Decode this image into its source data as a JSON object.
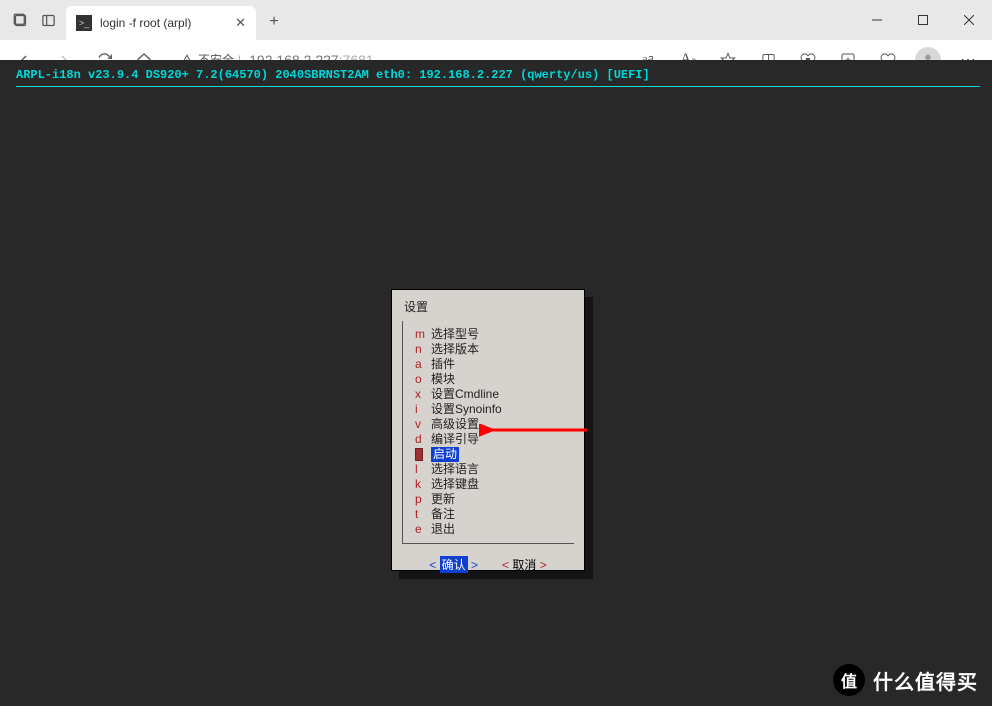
{
  "tab": {
    "title": "login -f root (arpl)"
  },
  "address": {
    "warn_text": "不安全",
    "host": "192.168.2.227",
    "port": ":7681"
  },
  "status_line": "ARPL-i18n v23.9.4 DS920+ 7.2(64570) 2040SBRNST2AM eth0: 192.168.2.227 (qwerty/us) [UEFI]",
  "dialog": {
    "title": "设置",
    "items": [
      {
        "key": "m",
        "label": "选择型号"
      },
      {
        "key": "n",
        "label": "选择版本"
      },
      {
        "key": "a",
        "label": "插件"
      },
      {
        "key": "o",
        "label": "模块"
      },
      {
        "key": "x",
        "label": "设置Cmdline"
      },
      {
        "key": "i",
        "label": "设置Synoinfo"
      },
      {
        "key": "v",
        "label": "高级设置"
      },
      {
        "key": "d",
        "label": "编译引导"
      },
      {
        "key": "",
        "label": "启动",
        "selected": true
      },
      {
        "key": "l",
        "label": "选择语言"
      },
      {
        "key": "k",
        "label": "选择键盘"
      },
      {
        "key": "p",
        "label": "更新"
      },
      {
        "key": "t",
        "label": "备注"
      },
      {
        "key": "e",
        "label": "退出"
      }
    ],
    "ok": "确认",
    "cancel": "取消"
  },
  "watermark": {
    "badge": "值",
    "text": "什么值得买"
  }
}
